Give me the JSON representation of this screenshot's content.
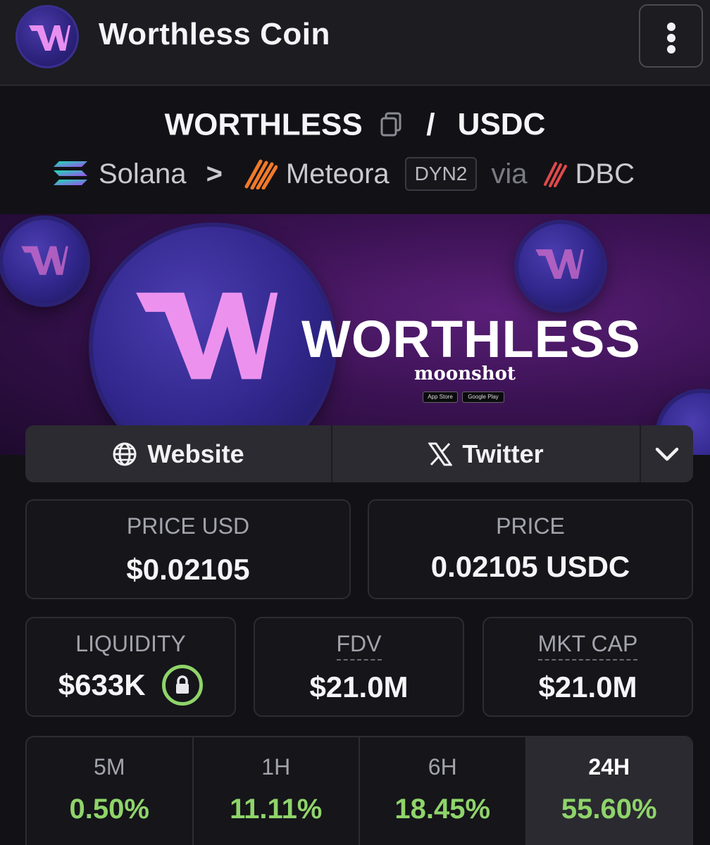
{
  "header": {
    "title": "Worthless Coin",
    "logo_letter": "W",
    "menu_icon": "kebab-menu-icon"
  },
  "pair": {
    "base": "WORTHLESS",
    "separator": "/",
    "quote": "USDC",
    "chain": "Solana",
    "chevron": ">",
    "dex": "Meteora",
    "pool_type": "DYN2",
    "via": "via",
    "launchpad": "DBC"
  },
  "banner": {
    "title": "WORTHLESS",
    "subtitle": "moonshot",
    "app_store": "App Store",
    "google_play": "Google Play"
  },
  "links": {
    "website": "Website",
    "twitter": "Twitter"
  },
  "stats": {
    "price_usd_label": "PRICE USD",
    "price_usd_value": "$0.02105",
    "price_label": "PRICE",
    "price_value": "0.02105 USDC",
    "liquidity_label": "LIQUIDITY",
    "liquidity_value": "$633K",
    "fdv_label": "FDV",
    "fdv_value": "$21.0M",
    "mktcap_label": "MKT CAP",
    "mktcap_value": "$21.0M"
  },
  "timeframes": [
    {
      "label": "5M",
      "value": "0.50%"
    },
    {
      "label": "1H",
      "value": "11.11%"
    },
    {
      "label": "6H",
      "value": "18.45%"
    },
    {
      "label": "24H",
      "value": "55.60%",
      "active": true
    }
  ],
  "colors": {
    "positive": "#8fd46a",
    "accent": "#e88ff0",
    "background": "#121216"
  }
}
